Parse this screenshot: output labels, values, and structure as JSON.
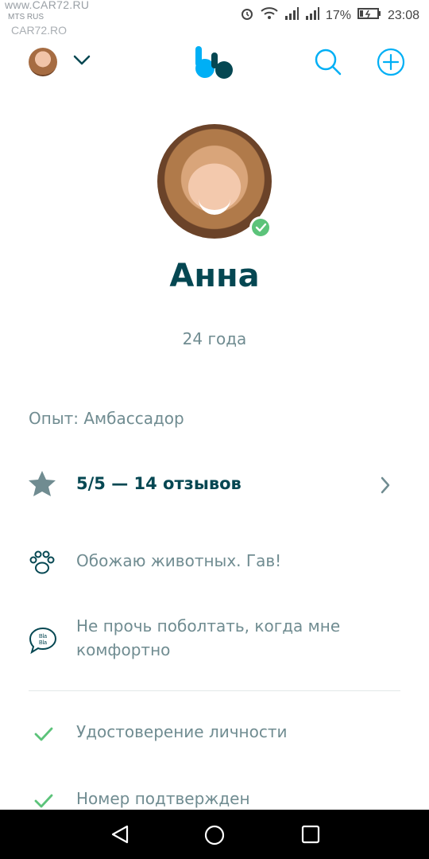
{
  "status_bar": {
    "watermark_line1": "www.CAR72.RU",
    "watermark_line2": "MTS RUS",
    "watermark_line3": "CAR72.RO",
    "battery": "17%",
    "time": "23:08"
  },
  "header": {
    "avatar_icon": "user-avatar",
    "chevron_icon": "chevron-down-icon",
    "logo_icon": "blablacar-logo",
    "search_icon": "search-icon",
    "add_icon": "plus-circle-icon",
    "accent_color": "#00aff5"
  },
  "profile": {
    "name": "Анна",
    "age": "24 года",
    "experience": "Опыт: Амбассадор",
    "verified_color": "#5cc37a"
  },
  "rating": {
    "text": "5/5 — 14 отзывов",
    "icon": "star-icon"
  },
  "preferences": [
    {
      "icon": "paw-icon",
      "text": "Обожаю животных. Гав!"
    },
    {
      "icon": "blabla-chat-icon",
      "icon_label": "Bla Bla",
      "text": "Не прочь поболтать, когда мне комфортно"
    }
  ],
  "verifications": [
    {
      "icon": "check-icon",
      "text": "Удостоверение личности"
    },
    {
      "icon": "check-icon",
      "text": "Номер подтвержден"
    }
  ],
  "nav": {
    "back_icon": "back-triangle-icon",
    "home_icon": "home-circle-icon",
    "recent_icon": "recents-square-icon"
  }
}
